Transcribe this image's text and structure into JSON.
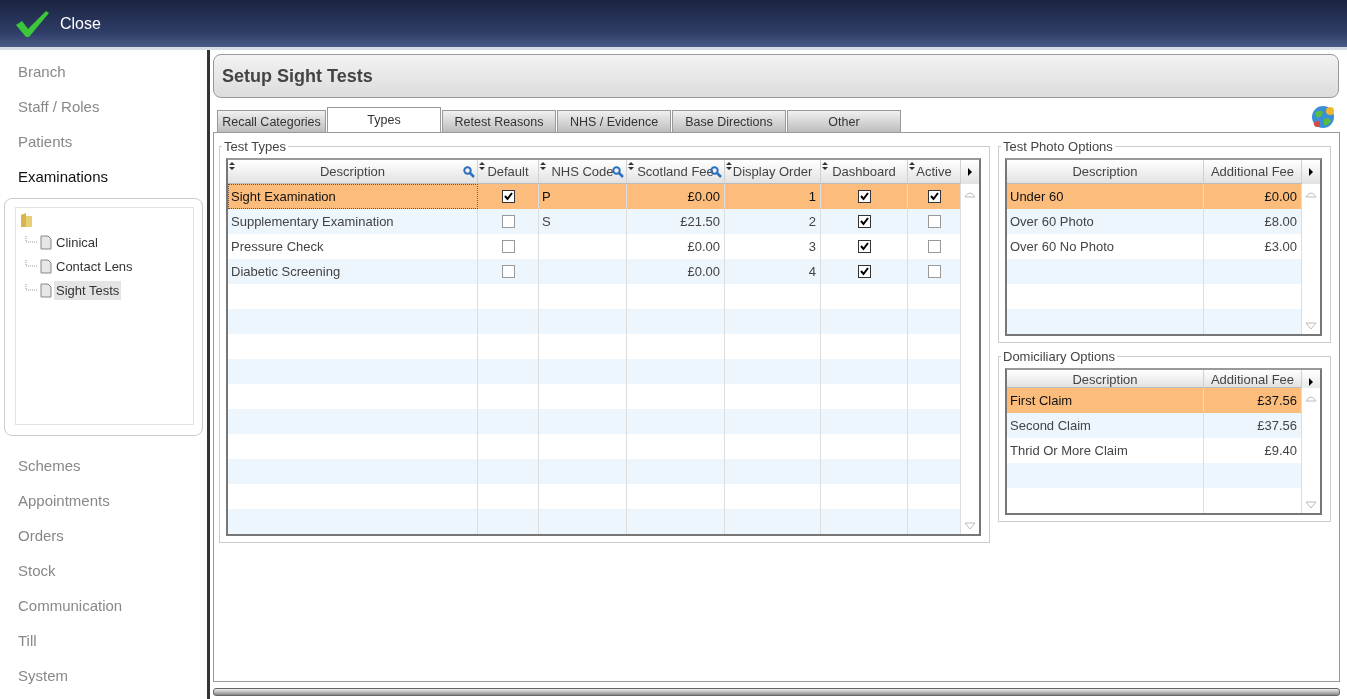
{
  "toolbar": {
    "close_label": "Close"
  },
  "nav": [
    {
      "label": "Branch",
      "selected": false
    },
    {
      "label": "Staff / Roles",
      "selected": false
    },
    {
      "label": "Patients",
      "selected": false
    },
    {
      "label": "Examinations",
      "selected": true
    }
  ],
  "tree": {
    "children": [
      {
        "label": "Clinical",
        "selected": false
      },
      {
        "label": "Contact Lens",
        "selected": false
      },
      {
        "label": "Sight Tests",
        "selected": true
      }
    ]
  },
  "nav_after": [
    {
      "label": "Schemes",
      "selected": false
    },
    {
      "label": "Appointments",
      "selected": false
    },
    {
      "label": "Orders",
      "selected": false
    },
    {
      "label": "Stock",
      "selected": false
    },
    {
      "label": "Communication",
      "selected": false
    },
    {
      "label": "Till",
      "selected": false
    },
    {
      "label": "System",
      "selected": false
    }
  ],
  "page_title": "Setup Sight Tests",
  "tabs": [
    {
      "label": "Recall Categories",
      "selected": false
    },
    {
      "label": "Types",
      "selected": true
    },
    {
      "label": "Retest Reasons",
      "selected": false
    },
    {
      "label": "NHS / Evidence",
      "selected": false
    },
    {
      "label": "Base Directions",
      "selected": false
    },
    {
      "label": "Other",
      "selected": false
    }
  ],
  "test_types": {
    "title": "Test Types",
    "columns": [
      {
        "label": "Description",
        "sortable": true,
        "searchable": true
      },
      {
        "label": "Default",
        "sortable": true,
        "searchable": false
      },
      {
        "label": "NHS Code",
        "sortable": true,
        "searchable": true
      },
      {
        "label": "Scotland Fee",
        "sortable": true,
        "searchable": true
      },
      {
        "label": "Display Order",
        "sortable": true,
        "searchable": false
      },
      {
        "label": "Dashboard",
        "sortable": true,
        "searchable": false
      },
      {
        "label": "Active",
        "sortable": true,
        "searchable": false
      }
    ],
    "rows": [
      {
        "selected": true,
        "description": "Sight Examination",
        "default": true,
        "nhs_code": "P",
        "scotland_fee": "£0.00",
        "display_order": "1",
        "dashboard": true,
        "active": true
      },
      {
        "selected": false,
        "description": "Supplementary Examination",
        "default": false,
        "nhs_code": "S",
        "scotland_fee": "£21.50",
        "display_order": "2",
        "dashboard": true,
        "active": false
      },
      {
        "selected": false,
        "description": "Pressure Check",
        "default": false,
        "scotland_fee": "£0.00",
        "display_order": "3",
        "dashboard": true,
        "active": false
      },
      {
        "selected": false,
        "description": "Diabetic Screening",
        "default": false,
        "scotland_fee": "£0.00",
        "display_order": "4",
        "dashboard": true,
        "active": false
      }
    ]
  },
  "test_photo_options": {
    "title": "Test Photo Options",
    "columns": [
      "Description",
      "Additional Fee"
    ],
    "rows": [
      {
        "selected": true,
        "description": "Under 60",
        "fee": "£0.00"
      },
      {
        "selected": false,
        "description": "Over 60 Photo",
        "fee": "£8.00"
      },
      {
        "selected": false,
        "description": "Over 60 No Photo",
        "fee": "£3.00"
      }
    ]
  },
  "domiciliary_options": {
    "title": "Domiciliary Options",
    "columns": [
      "Description",
      "Additional Fee"
    ],
    "rows": [
      {
        "selected": true,
        "description": "First Claim",
        "fee": "£37.56"
      },
      {
        "selected": false,
        "description": "Second Claim",
        "fee": "£37.56"
      },
      {
        "selected": false,
        "description": "Thrid Or More Claim",
        "fee": "£9.40"
      }
    ]
  }
}
